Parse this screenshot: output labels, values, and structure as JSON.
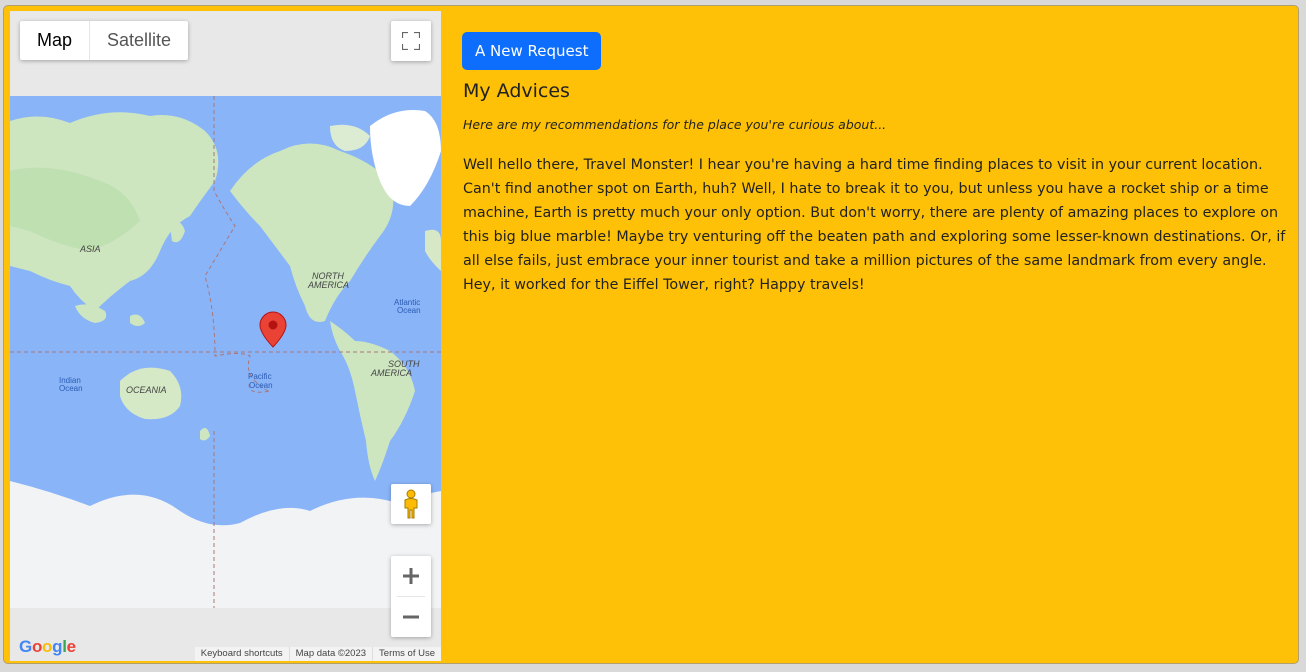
{
  "map": {
    "type_options": [
      "Map",
      "Satellite"
    ],
    "selected_type": "Map",
    "labels": {
      "asia": "ASIA",
      "north_america_1": "NORTH",
      "north_america_2": "AMERICA",
      "south_america_1": "SOUTH",
      "south_america_2": "AMERICA",
      "oceania": "OCEANIA",
      "atlantic_1": "Atlantic",
      "atlantic_2": "Ocean",
      "pacific_1": "Pacific",
      "pacific_2": "Ocean",
      "indian_1": "Indian",
      "indian_2": "Ocean"
    },
    "logo": "Google",
    "attribution": {
      "shortcuts": "Keyboard shortcuts",
      "data": "Map data ©2023",
      "terms": "Terms of Use"
    },
    "colors": {
      "water": "#8ab4f8",
      "land": "#cfe8c4",
      "marker": "#ea4335"
    }
  },
  "panel": {
    "button_label": "A New Request",
    "title": "My Advices",
    "subtitle": "Here are my recommendations for the place you're curious about...",
    "advice": "Well hello there, Travel Monster! I hear you're having a hard time finding places to visit in your current location. Can't find another spot on Earth, huh? Well, I hate to break it to you, but unless you have a rocket ship or a time machine, Earth is pretty much your only option. But don't worry, there are plenty of amazing places to explore on this big blue marble! Maybe try venturing off the beaten path and exploring some lesser-known destinations. Or, if all else fails, just embrace your inner tourist and take a million pictures of the same landmark from every angle. Hey, it worked for the Eiffel Tower, right? Happy travels!",
    "colors": {
      "background": "#ffc107",
      "button": "#0d6efd"
    }
  }
}
